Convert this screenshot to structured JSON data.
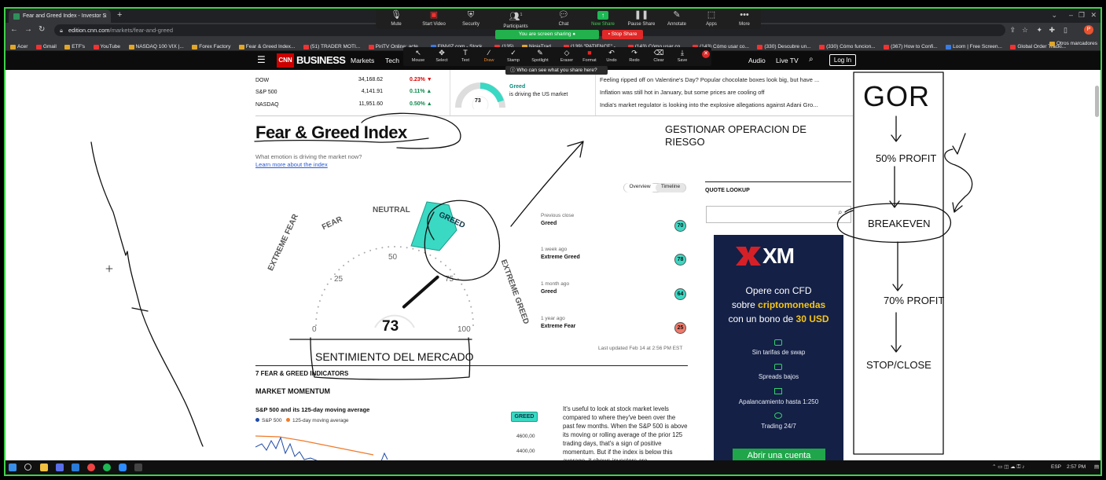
{
  "browser": {
    "tab_title": "Fear and Greed Index - Investor S",
    "tab_close": "×",
    "new_tab": "+",
    "url_host": "edition.cnn.com",
    "url_path": "/markets/fear-and-greed",
    "bookmarks": [
      "Acer",
      "Gmail",
      "ETF's",
      "YouTube",
      "NASDAQ 100 VIX |...",
      "Forex Factory",
      "Fear & Greed Index...",
      "(51) TRADER MOTI...",
      "PiriTV Online: acte...",
      "FINVIZ.com - Stock...",
      "(135) ",
      "NinjaTrad...",
      "(139) \"PATIENCE\" -...",
      "(143) Cómo usar co...",
      "(143) Cómo usar co...",
      "(330) Descubre un...",
      "(330) Cómo funcion...",
      "(367) How to Confi...",
      "Loom | Free Screen...",
      "Global Order Tracki..."
    ],
    "other_bookmarks": "Otros marcadores",
    "profile_initial": "P"
  },
  "zoom": {
    "toolbar": [
      {
        "label": "Mute",
        "icon": "🎙"
      },
      {
        "label": "Start Video",
        "icon": "📷"
      },
      {
        "label": "Security",
        "icon": "🛡"
      },
      {
        "label": "Participants",
        "icon": "👥"
      },
      {
        "label": "Chat",
        "icon": "💬"
      },
      {
        "label": "New Share",
        "icon": "↑"
      },
      {
        "label": "Pause Share",
        "icon": "❚❚"
      },
      {
        "label": "Annotate",
        "icon": "✎"
      },
      {
        "label": "Apps",
        "icon": "⬚"
      },
      {
        "label": "More",
        "icon": "•••"
      }
    ],
    "participants_count": "1",
    "sharing_status": "You are screen sharing",
    "stop_share": "Stop Share",
    "annotate_tools": [
      {
        "label": "Mouse",
        "icon": "↖"
      },
      {
        "label": "Select",
        "icon": "✥"
      },
      {
        "label": "Text",
        "icon": "T"
      },
      {
        "label": "Draw",
        "icon": "∕"
      },
      {
        "label": "Stamp",
        "icon": "✓"
      },
      {
        "label": "Spotlight",
        "icon": "✎"
      },
      {
        "label": "Eraser",
        "icon": "◇"
      },
      {
        "label": "Format",
        "icon": "■"
      },
      {
        "label": "Undo",
        "icon": "↶"
      },
      {
        "label": "Redo",
        "icon": "↷"
      },
      {
        "label": "Clear",
        "icon": "⌫"
      },
      {
        "label": "Save",
        "icon": "⤓"
      }
    ],
    "who_can_see": "Who can see what you share here?"
  },
  "cnn": {
    "logo_mark": "CNN",
    "logo_text": "BUSINESS",
    "nav": [
      "Markets",
      "Tech"
    ],
    "right_nav": [
      "Audio",
      "Live TV"
    ],
    "login": "Log In"
  },
  "tickers": [
    {
      "name": "DOW",
      "value": "34,168.62",
      "change": "0.23%",
      "dir": "down"
    },
    {
      "name": "S&P 500",
      "value": "4,141.91",
      "change": "0.11%",
      "dir": "up"
    },
    {
      "name": "NASDAQ",
      "value": "11,951.60",
      "change": "0.50%",
      "dir": "up"
    }
  ],
  "mini_gauge": {
    "value": "73",
    "label": "Greed",
    "sub": "is driving the US market"
  },
  "news": [
    "Feeling ripped off on Valentine's Day? Popular chocolate boxes look big, but have ...",
    "Inflation was still hot in January, but some prices are cooling off",
    "India's market regulator is looking into the explosive allegations against Adani Gro..."
  ],
  "page": {
    "title": "Fear & Greed Index",
    "subtitle": "What emotion is driving the market now?",
    "learn_more": "Learn more about the index"
  },
  "gauge": {
    "value": 73,
    "value_text": "73",
    "labels": {
      "extreme_fear": "EXTREME FEAR",
      "fear": "FEAR",
      "neutral": "NEUTRAL",
      "greed": "GREED",
      "extreme_greed": "EXTREME GREED"
    },
    "ticks": [
      "0",
      "25",
      "50",
      "75",
      "100"
    ]
  },
  "tabs": [
    "Overview",
    "Timeline"
  ],
  "history": [
    {
      "label": "Previous close",
      "value": "Greed",
      "score": "70",
      "color": "#3ad9c4"
    },
    {
      "label": "1 week ago",
      "value": "Extreme Greed",
      "score": "78",
      "color": "#3ad9c4"
    },
    {
      "label": "1 month ago",
      "value": "Greed",
      "score": "64",
      "color": "#3ad9c4"
    },
    {
      "label": "1 year ago",
      "value": "Extreme Fear",
      "score": "25",
      "color": "#f07a6a"
    }
  ],
  "last_updated": "Last updated Feb 14 at 2:56 PM EST",
  "indicators_title": "7 FEAR & GREED INDICATORS",
  "market_momentum": {
    "title": "MARKET MOMENTUM",
    "chart_title": "S&P 500 and its 125-day moving average",
    "legend": [
      "S&P 500",
      "125-day moving average"
    ],
    "badge": "GREED",
    "y_labels": [
      "4600,00",
      "4400,00"
    ],
    "paragraph": "It's useful to look at stock market levels compared to where they've been over the past few months. When the S&P 500 is above its moving or rolling average of the prior 125 trading days, that's a sign of positive momentum. But if the index is below this average, it shows investors are"
  },
  "quote_lookup": {
    "title": "QUOTE LOOKUP",
    "placeholder": ""
  },
  "ad": {
    "brand": "XM",
    "line1": "Opere con CFD",
    "line2_pre": "sobre ",
    "line2_hl": "criptomonedas",
    "line3_pre": "con un bono de ",
    "line3_hl": "30 USD",
    "features": [
      "Sin tarifas de swap",
      "Spreads bajos",
      "Apalancamiento hasta 1:250",
      "Trading 24/7"
    ],
    "cta": "Abrir una cuenta"
  },
  "handwriting": {
    "gor": "GOR",
    "step1": "50% PROFIT",
    "step2": "BREAKEVEN",
    "step3": "70% PROFIT",
    "step4": "STOP/CLOSE",
    "risk": "GESTIONAR OPERACION DE RIESGO",
    "sentiment": "SENTIMIENTO DEL MERCADO"
  },
  "taskbar": {
    "lang": "ESP",
    "time": "2:57 PM"
  },
  "colors": {
    "share_green": "#3fd14a",
    "greed_teal": "#3ad9c4",
    "cnn_red": "#cc0000",
    "ad_bg": "#142046",
    "cta_green": "#1fa64a"
  }
}
